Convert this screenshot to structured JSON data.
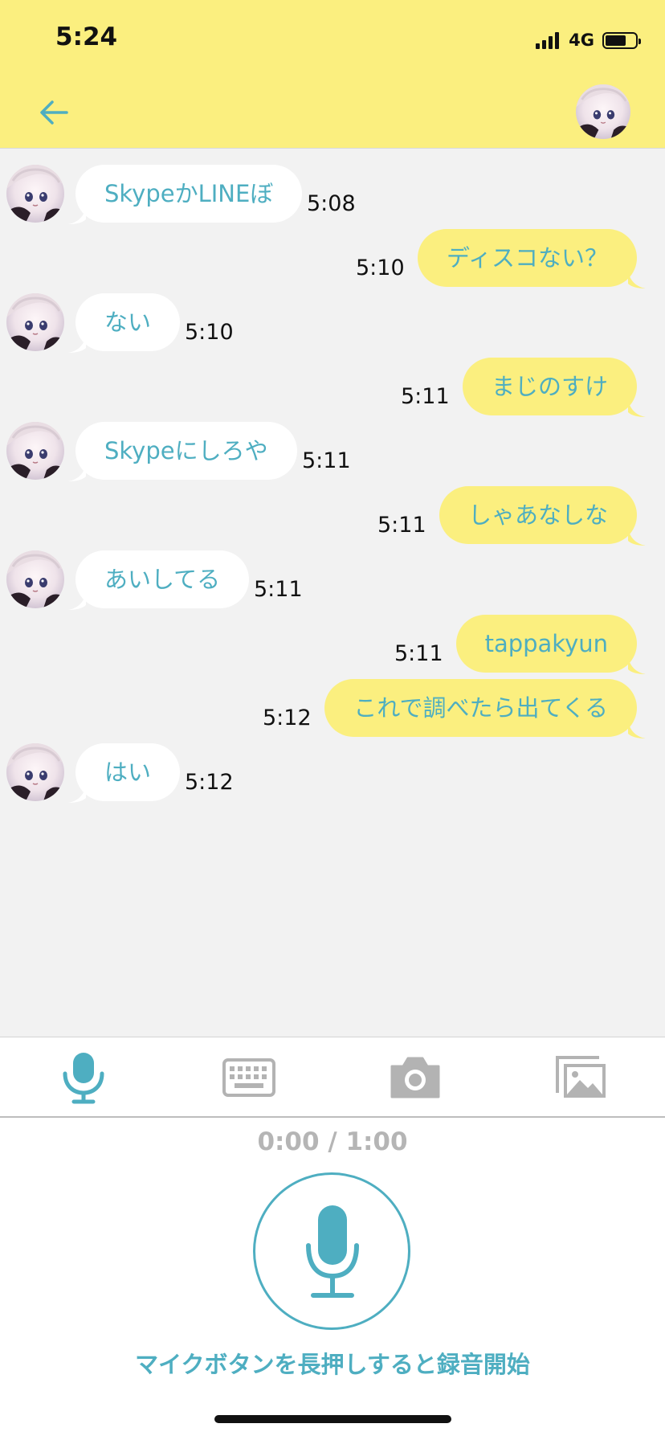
{
  "status_bar": {
    "time": "5:24",
    "network": "4G",
    "battery_level": 0.7
  },
  "header": {
    "back_icon": "arrow-left-icon",
    "avatar": "contact-avatar"
  },
  "colors": {
    "header_bg": "#fbef7f",
    "outgoing_bubble": "#fbef7f",
    "incoming_bubble": "#ffffff",
    "accent": "#4eaec1",
    "chat_bg": "#f2f2f2"
  },
  "messages": [
    {
      "direction": "in",
      "text": "SkypeかLINEぼ",
      "time": "5:08"
    },
    {
      "direction": "out",
      "text": "ディスコない？",
      "time": "5:10"
    },
    {
      "direction": "in",
      "text": "ない",
      "time": "5:10"
    },
    {
      "direction": "out",
      "text": "まじのすけ",
      "time": "5:11"
    },
    {
      "direction": "in",
      "text": "Skypeにしろや",
      "time": "5:11"
    },
    {
      "direction": "out",
      "text": "しゃあなしな",
      "time": "5:11"
    },
    {
      "direction": "in",
      "text": "あいしてる",
      "time": "5:11"
    },
    {
      "direction": "out",
      "text": "tappakyun",
      "time": "5:11"
    },
    {
      "direction": "out",
      "text": "これで調べたら出てくる",
      "time": "5:12"
    },
    {
      "direction": "in",
      "text": "はい",
      "time": "5:12"
    }
  ],
  "toolbar": {
    "items": [
      {
        "icon": "microphone-icon",
        "active": true
      },
      {
        "icon": "keyboard-icon",
        "active": false
      },
      {
        "icon": "camera-icon",
        "active": false
      },
      {
        "icon": "image-gallery-icon",
        "active": false
      }
    ]
  },
  "recorder": {
    "time_display": "0:00 / 1:00",
    "hint": "マイクボタンを長押しすると録音開始",
    "button_icon": "microphone-icon"
  }
}
